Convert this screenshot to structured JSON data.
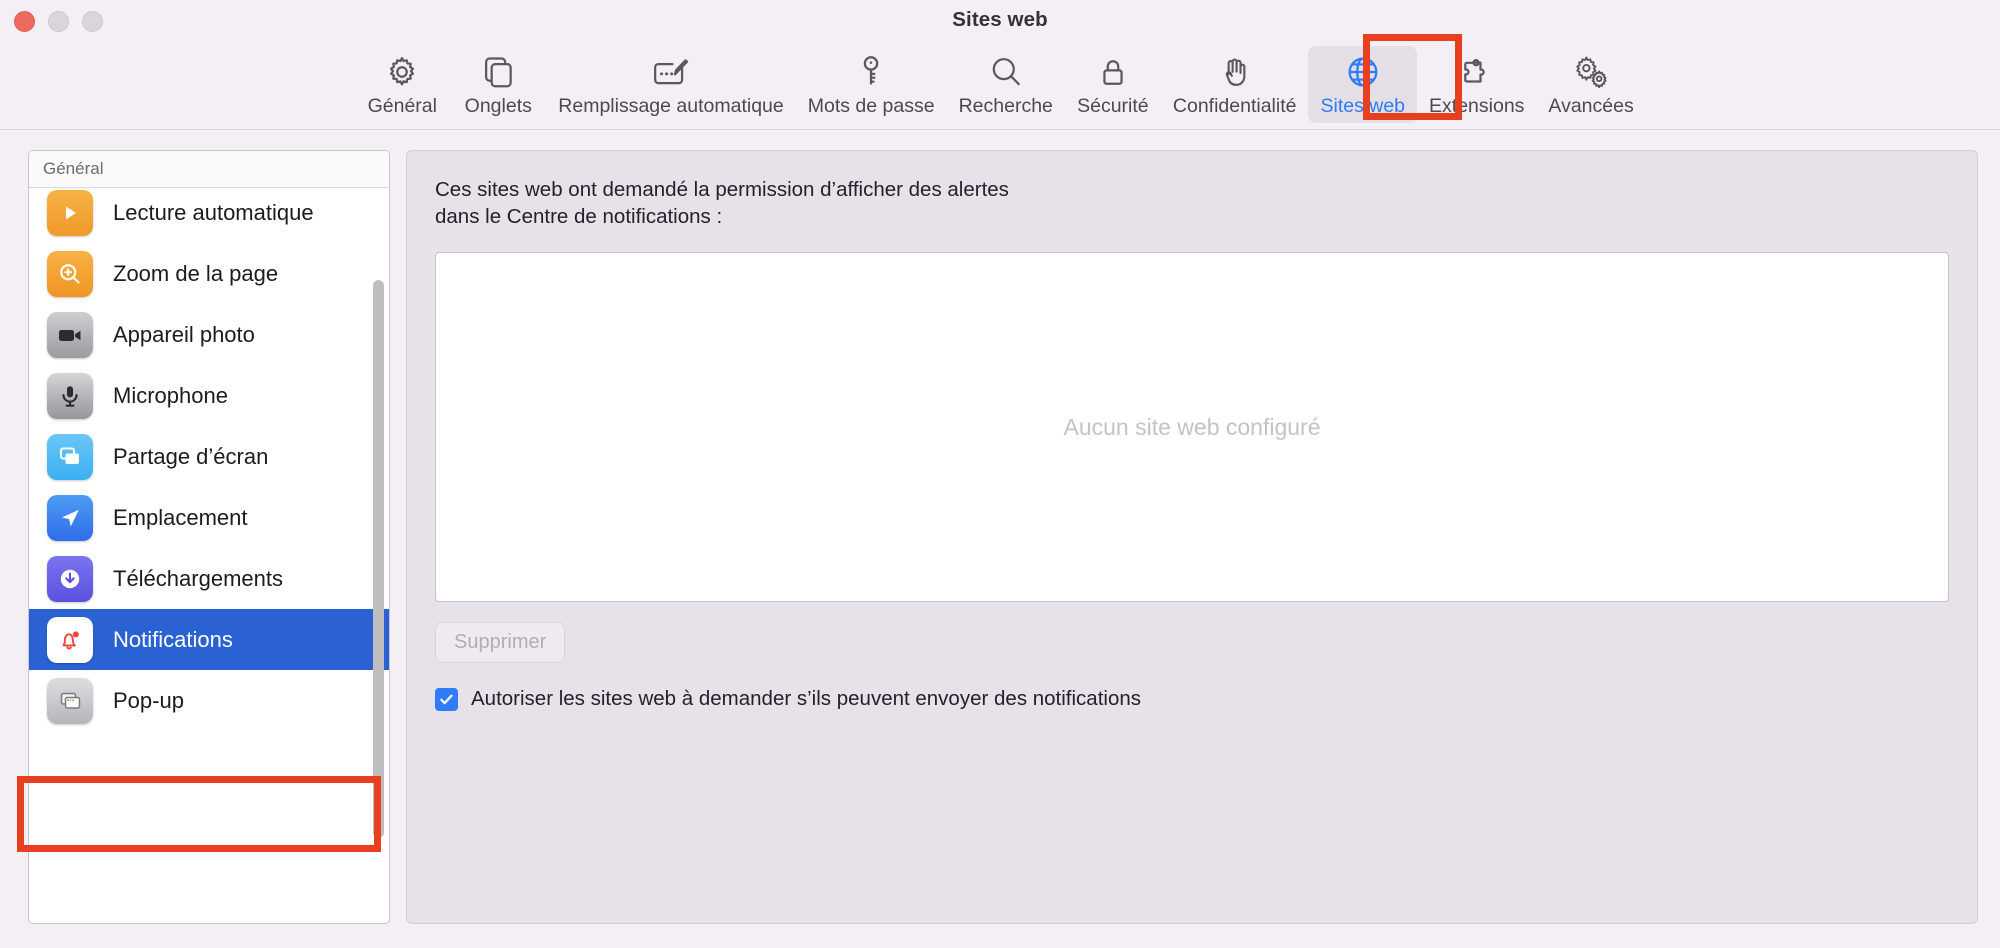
{
  "window": {
    "title": "Sites web",
    "traffic_lights": [
      "close",
      "minimize",
      "maximize"
    ]
  },
  "toolbar": {
    "items": [
      {
        "label": "Général",
        "icon": "gear-icon",
        "selected": false
      },
      {
        "label": "Onglets",
        "icon": "tabs-icon",
        "selected": false
      },
      {
        "label": "Remplissage automatique",
        "icon": "autofill-icon",
        "selected": false
      },
      {
        "label": "Mots de passe",
        "icon": "key-icon",
        "selected": false
      },
      {
        "label": "Recherche",
        "icon": "search-icon",
        "selected": false
      },
      {
        "label": "Sécurité",
        "icon": "lock-icon",
        "selected": false
      },
      {
        "label": "Confidentialité",
        "icon": "hand-icon",
        "selected": false
      },
      {
        "label": "Sites web",
        "icon": "globe-icon",
        "selected": true
      },
      {
        "label": "Extensions",
        "icon": "puzzle-icon",
        "selected": false
      },
      {
        "label": "Avancées",
        "icon": "double-gear-icon",
        "selected": false
      }
    ],
    "selected_color": "#2f7cf6"
  },
  "sidebar": {
    "header": "Général",
    "selected_color": "#2a62d4",
    "items": [
      {
        "label": "Lecture automatique",
        "icon": "play-icon",
        "selected": false
      },
      {
        "label": "Zoom de la page",
        "icon": "zoom-icon",
        "selected": false
      },
      {
        "label": "Appareil photo",
        "icon": "camera-icon",
        "selected": false
      },
      {
        "label": "Microphone",
        "icon": "microphone-icon",
        "selected": false
      },
      {
        "label": "Partage d’écran",
        "icon": "screen-share-icon",
        "selected": false
      },
      {
        "label": "Emplacement",
        "icon": "location-icon",
        "selected": false
      },
      {
        "label": "Téléchargements",
        "icon": "download-icon",
        "selected": false
      },
      {
        "label": "Notifications",
        "icon": "bell-icon",
        "selected": true
      },
      {
        "label": "Pop-up",
        "icon": "popup-icon",
        "selected": false
      }
    ]
  },
  "main": {
    "description": "Ces sites web ont demandé la permission d’afficher des alertes\ndans le Centre de notifications :",
    "empty_message": "Aucun site web configuré",
    "delete_button": "Supprimer",
    "delete_button_disabled": true,
    "checkbox": {
      "label": "Autoriser les sites web à demander s’ils peuvent envoyer des notifications",
      "checked": true,
      "color": "#2f7cf6"
    }
  },
  "annotations": {
    "highlight_color": "#e8401f",
    "boxes": [
      {
        "target": "toolbar-item-sites-web"
      },
      {
        "target": "sidebar-item-notifications"
      }
    ]
  }
}
